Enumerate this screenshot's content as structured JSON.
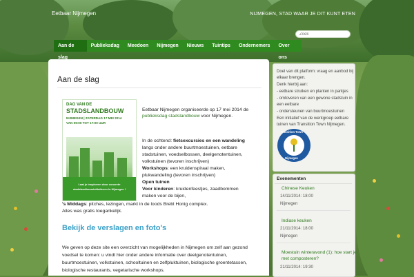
{
  "site": {
    "title": "Eetbaar Nijmegen",
    "tagline": "NIJMEGEN, STAD WAAR JE DIT KUNT ETEN",
    "search_placeholder": "Zoek"
  },
  "nav": {
    "items": [
      {
        "label": "Aan de slag"
      },
      {
        "label": "Publieksdag"
      },
      {
        "label": "Meedoen"
      },
      {
        "label": "Nijmegen"
      },
      {
        "label": "Nieuws"
      },
      {
        "label": "Tuintips"
      },
      {
        "label": "Ondernemers"
      },
      {
        "label": "Over ons"
      }
    ]
  },
  "page": {
    "title": "Aan de slag"
  },
  "poster": {
    "line1": "DAG VAN DE",
    "line2": "STADSLANDBOUW",
    "line3": "NIJMEGEN | ZATERDAG 17 MEI 2014",
    "line4": "VAN 09:00 TOT 17:00 UUR",
    "band1": "Laat je inspireren door concrete",
    "band2": "stadslandbouwinitiatieven in Nijmegen !"
  },
  "article": {
    "intro_pre": "Eetbaar Nijmegen organiseerde op 17 mei 2014 de",
    "intro_link": "publieksdag stadslandbouw",
    "intro_post": "voor Nijmegen.",
    "morning_label": "In de ochtend:",
    "morning_bold": "fietsexcursies en een wandeling",
    "morning_l1": "langs onder andere buurtmoestuinen, eetbare",
    "morning_l2": "stadstuinen, voedselbossen, deelgenotentuinen,",
    "morning_l3": "volkstuinen (tevoren inschrijven)",
    "workshops_label": "Workshops",
    "workshops_l1": ": een kruidenspiraal maken,",
    "workshops_l2": "plukwandeling  (tevoren inschrijven)",
    "open": "Open tuinen",
    "kids_label": "Voor kinderen",
    "kids_l1": ": kruidenfeestjes, zaadbommen",
    "kids_l2": "maken voor de bijen,",
    "afternoon_label": "'s Middags",
    "afternoon_l1": ": pitches, lezingen, markt in de loods Brebl Honig complex.",
    "free": "Alles was gratis toegankelijk.",
    "section_heading": "Bekijk de verslagen en foto's",
    "p2_l1": "We geven op deze site een overzicht van mogelijkheden in Nijmegen om zelf aan gezond",
    "p2_l2": "voedsel te komen: u vindt hier onder andere informatie over deelgenotentuinen,",
    "p2_l3": "buurtmoestuinen, volkstuinen, schooltuinen en zelfpluktuinen, biologische groentetassen,",
    "p2_l4": "biologische restaurants, vegetarische workshops."
  },
  "sidebar": {
    "lines": [
      "Doel van dit platform: vraag en aanbod bij",
      "elkaar brengen.",
      "Denk hierbij aan:",
      "- eetbare struiken en planten in parkjes",
      "- omtoveren van een gewone stadstuin in",
      "een eetbare",
      "- ondersteunen van buurtmoestuinen",
      "Een initiatief van de werkgroep eetbare",
      "tuinen van Transition Town Nijmegen."
    ],
    "badge_top": "Transition Town",
    "badge_bottom": "Nijmegen"
  },
  "events": {
    "heading": "Evenementen",
    "items": [
      {
        "title": "Chinese Keuken",
        "date": "14/11/2014: 18:00",
        "location": "Nijmegen"
      },
      {
        "title": "Indiase keuken",
        "date": "21/11/2014: 18:00",
        "location": "Nijmegen"
      },
      {
        "title_l1": "Moestuin winteravond (1): hoe start je",
        "title_l2": "met composteren?",
        "date": "21/11/2014: 19:30"
      }
    ]
  },
  "colors": {
    "nav_green": "#2f8b1f",
    "link_green": "#2f7a1f",
    "heading_blue": "#3aa0c8"
  }
}
